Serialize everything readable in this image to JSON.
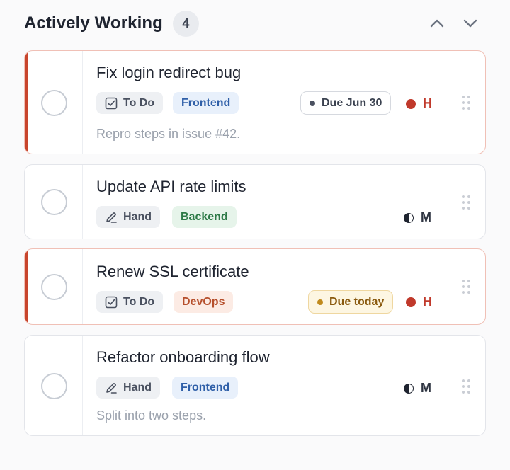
{
  "section": {
    "title": "Actively Working",
    "count": "4"
  },
  "tasks": [
    {
      "title": "Fix login redirect bug",
      "status": "To Do",
      "status_icon": "checkbox-icon",
      "tag": "Frontend",
      "due": "Due Jun 30",
      "priority": "H",
      "note": "Repro steps in issue #42."
    },
    {
      "title": "Update API rate limits",
      "status": "Hand",
      "status_icon": "pencil-icon",
      "tag": "Backend",
      "priority": "M"
    },
    {
      "title": "Renew SSL certificate",
      "status": "To Do",
      "status_icon": "checkbox-icon",
      "tag": "DevOps",
      "due": "Due today",
      "priority": "H"
    },
    {
      "title": "Refactor onboarding flow",
      "status": "Hand",
      "status_icon": "pencil-icon",
      "tag": "Frontend",
      "priority": "M",
      "note": "Split into two steps."
    }
  ],
  "colors": {
    "urgent_accent": "#c8452d",
    "high_priority": "#c0392b",
    "frontend": "#2f5fa8",
    "backend": "#2d7a47",
    "devops": "#b64f2c",
    "due_today": "#8a5a0f"
  }
}
